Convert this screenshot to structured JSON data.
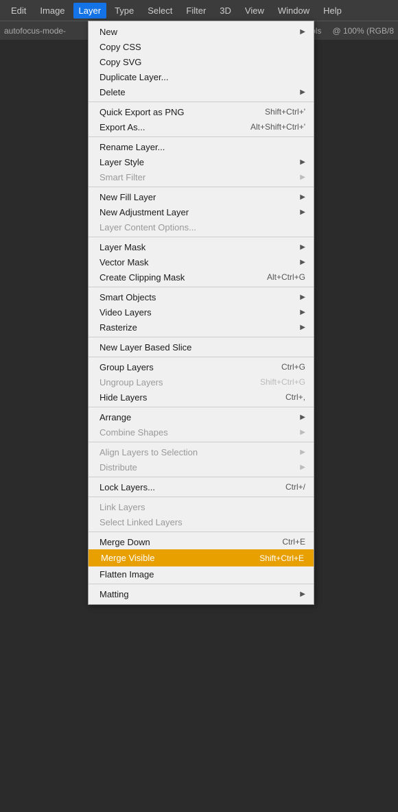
{
  "menubar": {
    "items": [
      {
        "label": "Edit",
        "active": false
      },
      {
        "label": "Image",
        "active": false
      },
      {
        "label": "Layer",
        "active": true
      },
      {
        "label": "Type",
        "active": false
      },
      {
        "label": "Select",
        "active": false
      },
      {
        "label": "Filter",
        "active": false
      },
      {
        "label": "3D",
        "active": false
      },
      {
        "label": "View",
        "active": false
      },
      {
        "label": "Window",
        "active": false
      },
      {
        "label": "Help",
        "active": false
      }
    ]
  },
  "toolbar": {
    "label1": "Aut",
    "label2": "Controls",
    "label3": "@ 100% (RGB/8"
  },
  "contextlabel": "autofocus-mode-",
  "menu": {
    "items": [
      {
        "id": "new",
        "label": "New",
        "shortcut": "",
        "hasArrow": true,
        "disabled": false,
        "separator_after": false
      },
      {
        "id": "copy-css",
        "label": "Copy CSS",
        "shortcut": "",
        "hasArrow": false,
        "disabled": false,
        "separator_after": false
      },
      {
        "id": "copy-svg",
        "label": "Copy SVG",
        "shortcut": "",
        "hasArrow": false,
        "disabled": false,
        "separator_after": false
      },
      {
        "id": "duplicate-layer",
        "label": "Duplicate Layer...",
        "shortcut": "",
        "hasArrow": false,
        "disabled": false,
        "separator_after": false
      },
      {
        "id": "delete",
        "label": "Delete",
        "shortcut": "",
        "hasArrow": true,
        "disabled": false,
        "separator_after": true
      },
      {
        "id": "quick-export",
        "label": "Quick Export as PNG",
        "shortcut": "Shift+Ctrl+'",
        "hasArrow": false,
        "disabled": false,
        "separator_after": false
      },
      {
        "id": "export-as",
        "label": "Export As...",
        "shortcut": "Alt+Shift+Ctrl+'",
        "hasArrow": false,
        "disabled": false,
        "separator_after": true
      },
      {
        "id": "rename-layer",
        "label": "Rename Layer...",
        "shortcut": "",
        "hasArrow": false,
        "disabled": false,
        "separator_after": false
      },
      {
        "id": "layer-style",
        "label": "Layer Style",
        "shortcut": "",
        "hasArrow": true,
        "disabled": false,
        "separator_after": false
      },
      {
        "id": "smart-filter",
        "label": "Smart Filter",
        "shortcut": "",
        "hasArrow": true,
        "disabled": true,
        "separator_after": true
      },
      {
        "id": "new-fill-layer",
        "label": "New Fill Layer",
        "shortcut": "",
        "hasArrow": true,
        "disabled": false,
        "separator_after": false
      },
      {
        "id": "new-adjustment-layer",
        "label": "New Adjustment Layer",
        "shortcut": "",
        "hasArrow": true,
        "disabled": false,
        "separator_after": false
      },
      {
        "id": "layer-content-options",
        "label": "Layer Content Options...",
        "shortcut": "",
        "hasArrow": false,
        "disabled": true,
        "separator_after": true
      },
      {
        "id": "layer-mask",
        "label": "Layer Mask",
        "shortcut": "",
        "hasArrow": true,
        "disabled": false,
        "separator_after": false
      },
      {
        "id": "vector-mask",
        "label": "Vector Mask",
        "shortcut": "",
        "hasArrow": true,
        "disabled": false,
        "separator_after": false
      },
      {
        "id": "create-clipping-mask",
        "label": "Create Clipping Mask",
        "shortcut": "Alt+Ctrl+G",
        "hasArrow": false,
        "disabled": false,
        "separator_after": true
      },
      {
        "id": "smart-objects",
        "label": "Smart Objects",
        "shortcut": "",
        "hasArrow": true,
        "disabled": false,
        "separator_after": false
      },
      {
        "id": "video-layers",
        "label": "Video Layers",
        "shortcut": "",
        "hasArrow": true,
        "disabled": false,
        "separator_after": false
      },
      {
        "id": "rasterize",
        "label": "Rasterize",
        "shortcut": "",
        "hasArrow": true,
        "disabled": false,
        "separator_after": true
      },
      {
        "id": "new-layer-based-slice",
        "label": "New Layer Based Slice",
        "shortcut": "",
        "hasArrow": false,
        "disabled": false,
        "separator_after": true
      },
      {
        "id": "group-layers",
        "label": "Group Layers",
        "shortcut": "Ctrl+G",
        "hasArrow": false,
        "disabled": false,
        "separator_after": false
      },
      {
        "id": "ungroup-layers",
        "label": "Ungroup Layers",
        "shortcut": "Shift+Ctrl+G",
        "hasArrow": false,
        "disabled": true,
        "separator_after": false
      },
      {
        "id": "hide-layers",
        "label": "Hide Layers",
        "shortcut": "Ctrl+,",
        "hasArrow": false,
        "disabled": false,
        "separator_after": true
      },
      {
        "id": "arrange",
        "label": "Arrange",
        "shortcut": "",
        "hasArrow": true,
        "disabled": false,
        "separator_after": false
      },
      {
        "id": "combine-shapes",
        "label": "Combine Shapes",
        "shortcut": "",
        "hasArrow": true,
        "disabled": true,
        "separator_after": true
      },
      {
        "id": "align-layers",
        "label": "Align Layers to Selection",
        "shortcut": "",
        "hasArrow": true,
        "disabled": true,
        "separator_after": false
      },
      {
        "id": "distribute",
        "label": "Distribute",
        "shortcut": "",
        "hasArrow": true,
        "disabled": true,
        "separator_after": true
      },
      {
        "id": "lock-layers",
        "label": "Lock Layers...",
        "shortcut": "Ctrl+/",
        "hasArrow": false,
        "disabled": false,
        "separator_after": true
      },
      {
        "id": "link-layers",
        "label": "Link Layers",
        "shortcut": "",
        "hasArrow": false,
        "disabled": true,
        "separator_after": false
      },
      {
        "id": "select-linked-layers",
        "label": "Select Linked Layers",
        "shortcut": "",
        "hasArrow": false,
        "disabled": true,
        "separator_after": true
      },
      {
        "id": "merge-down",
        "label": "Merge Down",
        "shortcut": "Ctrl+E",
        "hasArrow": false,
        "disabled": false,
        "separator_after": false
      },
      {
        "id": "merge-visible",
        "label": "Merge Visible",
        "shortcut": "Shift+Ctrl+E",
        "hasArrow": false,
        "disabled": false,
        "highlighted": true,
        "separator_after": false
      },
      {
        "id": "flatten-image",
        "label": "Flatten Image",
        "shortcut": "",
        "hasArrow": false,
        "disabled": false,
        "separator_after": true
      },
      {
        "id": "matting",
        "label": "Matting",
        "shortcut": "",
        "hasArrow": true,
        "disabled": false,
        "separator_after": false
      }
    ]
  }
}
